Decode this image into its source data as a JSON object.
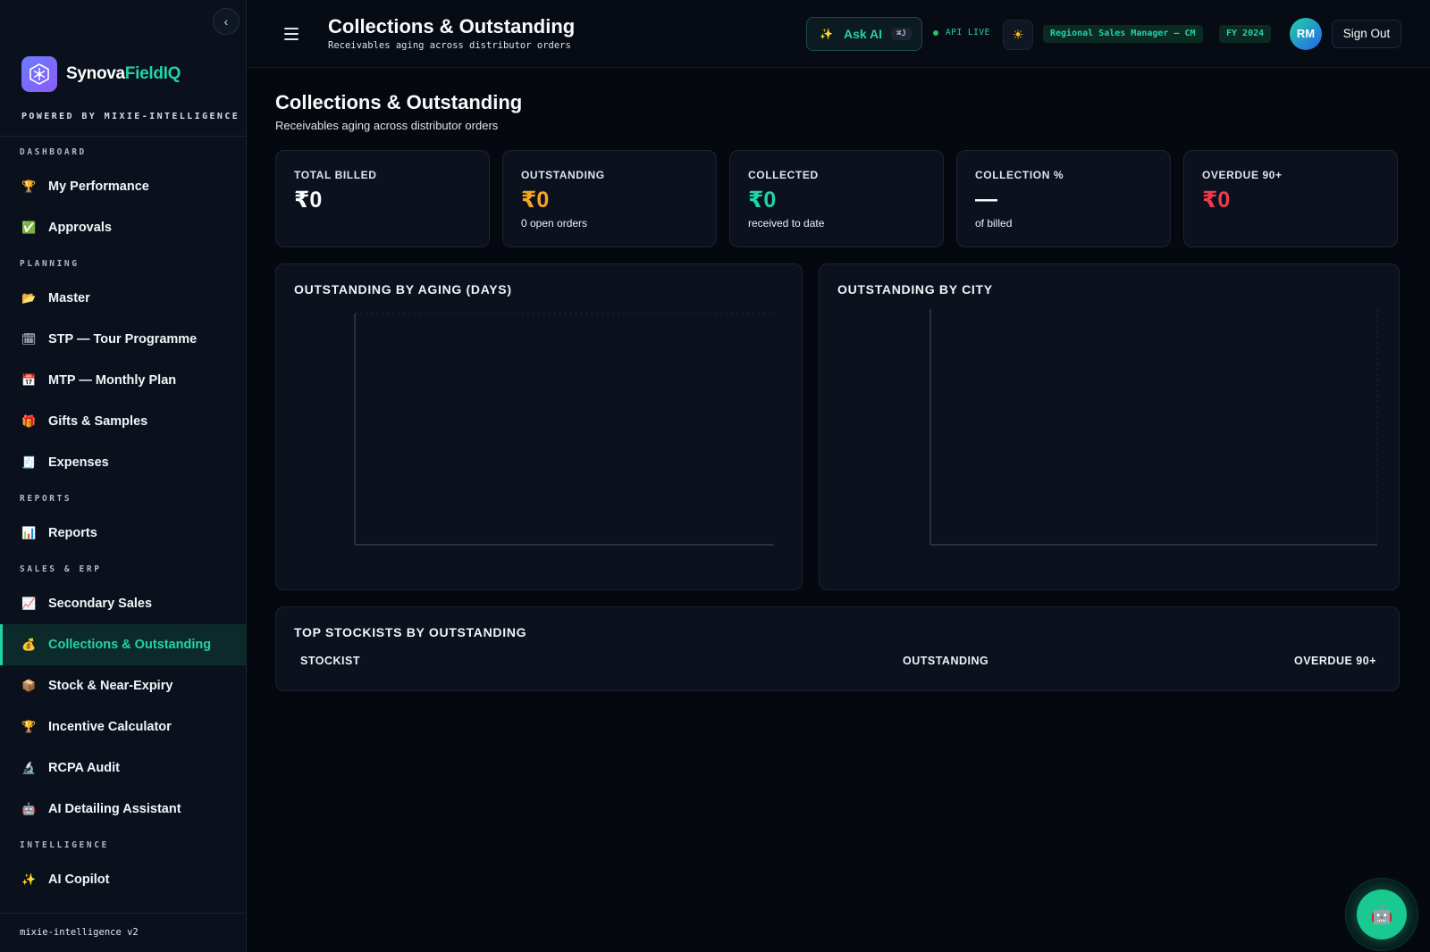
{
  "sidebar": {
    "brand": {
      "name_main": "Synova",
      "name_accent": "FieldIQ",
      "tagline": "POWERED BY MIXIE-INTELLIGENCE"
    },
    "collapse_glyph": "‹",
    "sections": [
      {
        "label": "DASHBOARD",
        "items": [
          {
            "label": "My Performance",
            "icon": "trophy-icon",
            "glyph": "🏆"
          },
          {
            "label": "Approvals",
            "icon": "check-box-icon",
            "glyph": "✅"
          }
        ]
      },
      {
        "label": "PLANNING",
        "items": [
          {
            "label": "Master",
            "icon": "folder-icon",
            "glyph": "📂"
          },
          {
            "label": "STP — Tour Programme",
            "icon": "calendar-icon",
            "glyph": "🗓"
          },
          {
            "label": "MTP — Monthly Plan",
            "icon": "calendar-date-icon",
            "glyph": "📅"
          },
          {
            "label": "Gifts & Samples",
            "icon": "gift-icon",
            "glyph": "🎁"
          },
          {
            "label": "Expenses",
            "icon": "receipt-icon",
            "glyph": "🧾"
          }
        ]
      },
      {
        "label": "REPORTS",
        "items": [
          {
            "label": "Reports",
            "icon": "bar-chart-icon",
            "glyph": "📊"
          }
        ]
      },
      {
        "label": "SALES & ERP",
        "items": [
          {
            "label": "Secondary Sales",
            "icon": "trend-chart-icon",
            "glyph": "📈"
          },
          {
            "label": "Collections & Outstanding",
            "icon": "money-bag-icon",
            "glyph": "💰",
            "active": true
          },
          {
            "label": "Stock & Near-Expiry",
            "icon": "package-icon",
            "glyph": "📦"
          },
          {
            "label": "Incentive Calculator",
            "icon": "trophy-icon",
            "glyph": "🏆"
          },
          {
            "label": "RCPA Audit",
            "icon": "microscope-icon",
            "glyph": "🔬"
          },
          {
            "label": "AI Detailing Assistant",
            "icon": "robot-icon",
            "glyph": "🤖"
          }
        ]
      },
      {
        "label": "INTELLIGENCE",
        "items": [
          {
            "label": "AI Copilot",
            "icon": "sparkles-icon",
            "glyph": "✨"
          }
        ]
      }
    ],
    "footer": "mixie-intelligence v2"
  },
  "topbar": {
    "title": "Collections & Outstanding",
    "subtitle": "Receivables aging across distributor orders",
    "ask_ai": {
      "label": "Ask AI",
      "shortcut": "⌘J",
      "glyph": "✨"
    },
    "api_status": "API LIVE",
    "theme_glyph": "☀",
    "role": "Regional Sales Manager — CM",
    "fiscal_year": "FY 2024",
    "avatar_initials": "RM",
    "sign_out": "Sign Out"
  },
  "page": {
    "title": "Collections & Outstanding",
    "subtitle": "Receivables aging across distributor orders"
  },
  "kpis": [
    {
      "label": "TOTAL BILLED",
      "value": "₹0",
      "note": "",
      "tone": "white"
    },
    {
      "label": "OUTSTANDING",
      "value": "₹0",
      "note": "0 open orders",
      "tone": "orange"
    },
    {
      "label": "COLLECTED",
      "value": "₹0",
      "note": "received to date",
      "tone": "green"
    },
    {
      "label": "COLLECTION %",
      "value": "—",
      "note": "of billed",
      "tone": "white"
    },
    {
      "label": "OVERDUE 90+",
      "value": "₹0",
      "note": "",
      "tone": "red"
    }
  ],
  "charts": {
    "aging_title": "OUTSTANDING BY AGING (DAYS)",
    "city_title": "OUTSTANDING BY CITY"
  },
  "chart_data": [
    {
      "type": "bar",
      "title": "OUTSTANDING BY AGING (DAYS)",
      "categories": [],
      "values": [],
      "grid": true
    },
    {
      "type": "bar",
      "title": "OUTSTANDING BY CITY",
      "categories": [],
      "values": [],
      "grid": true
    }
  ],
  "table": {
    "title": "TOP STOCKISTS BY OUTSTANDING",
    "columns": [
      "STOCKIST",
      "OUTSTANDING",
      "OVERDUE 90+"
    ],
    "rows": []
  },
  "colors": {
    "accent": "#22d3a6",
    "orange": "#f5a524",
    "red": "#ef3b4b",
    "background": "#05080f",
    "panel": "#0b111d"
  },
  "fab": {
    "icon": "robot-icon",
    "glyph": "🤖"
  }
}
